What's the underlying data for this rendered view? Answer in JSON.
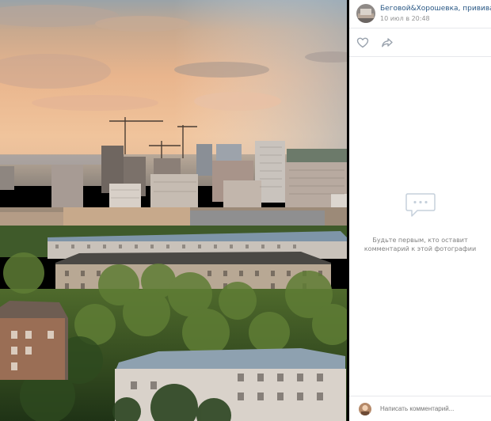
{
  "post": {
    "author": "Беговой&Хорошевка, прививайся!",
    "date": "10 июл в 20:48"
  },
  "actions": {
    "like_icon": "heart-icon",
    "share_icon": "share-arrow-icon"
  },
  "comments": {
    "empty_line1": "Будьте первым, кто оставит",
    "empty_line2": "комментарий к этой фотографии"
  },
  "comment_input": {
    "placeholder": "Написать комментарий..."
  },
  "colors": {
    "link": "#2a5885",
    "muted": "#828282",
    "icon": "#99a2ad"
  }
}
